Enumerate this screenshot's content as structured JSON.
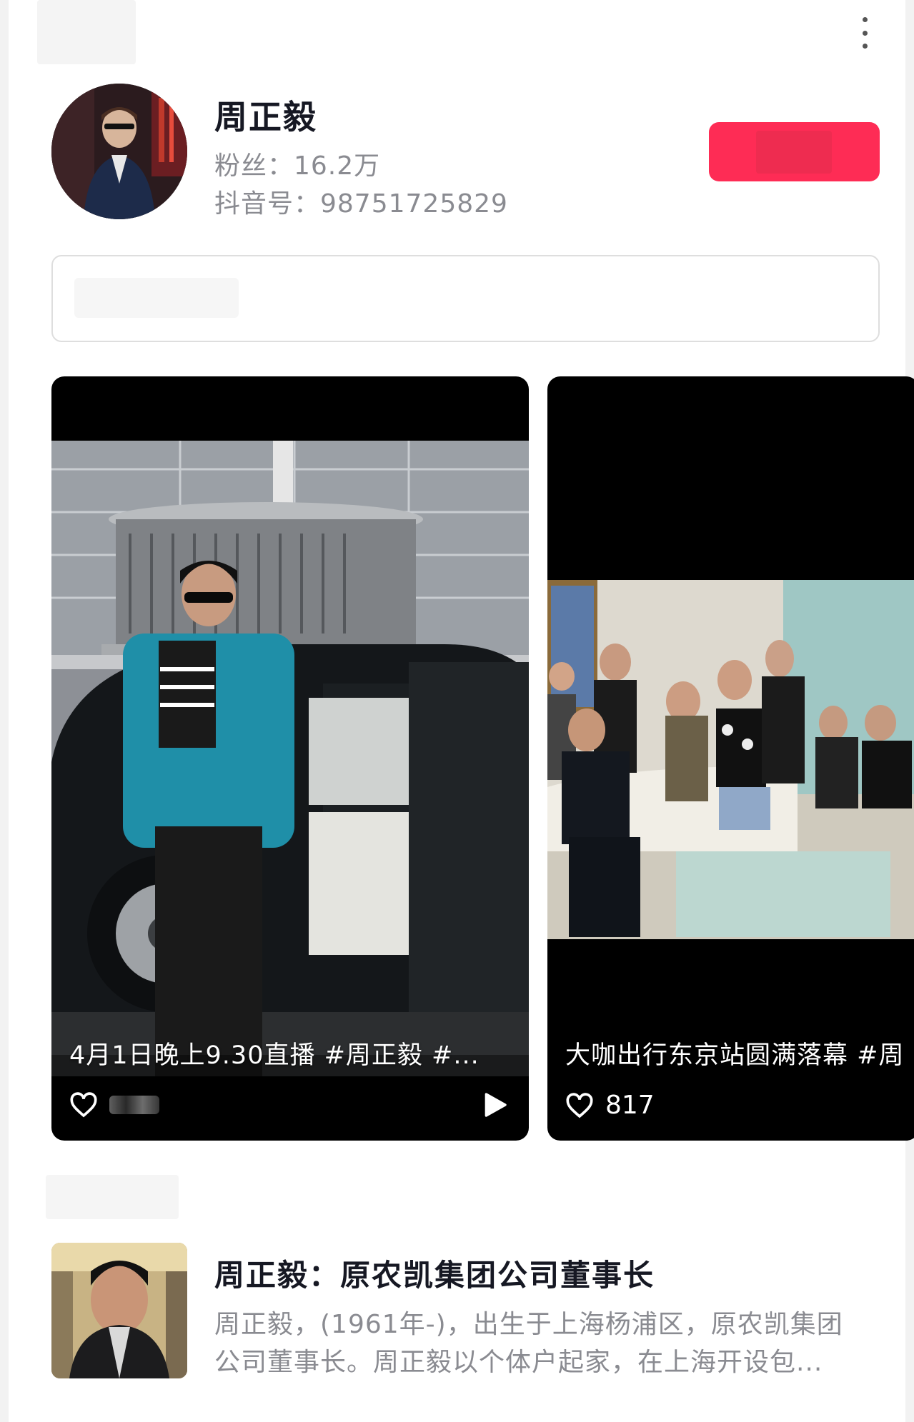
{
  "profile": {
    "name": "周正毅",
    "fans": "粉丝：16.2万",
    "douyin_id": "抖音号：98751725829"
  },
  "videos": [
    {
      "caption": "4月1日晚上9.30直播 #周正毅 #...",
      "likes": "",
      "has_play_icon": true
    },
    {
      "caption": "大咖出行东京站圆满落幕 #周",
      "likes": "817"
    }
  ],
  "article": {
    "title": "周正毅：原农凯集团公司董事长",
    "line1": "周正毅，(1961年-)，出生于上海杨浦区，原农凯集团",
    "line2": "公司董事长。周正毅以个体户起家，在上海开设包..."
  },
  "colors": {
    "accent": "#fe2c55",
    "text_primary": "#161823",
    "text_secondary": "#8a8b91",
    "card_bg": "#000000"
  },
  "icons": [
    "more-vertical-icon",
    "heart-icon",
    "play-icon"
  ]
}
